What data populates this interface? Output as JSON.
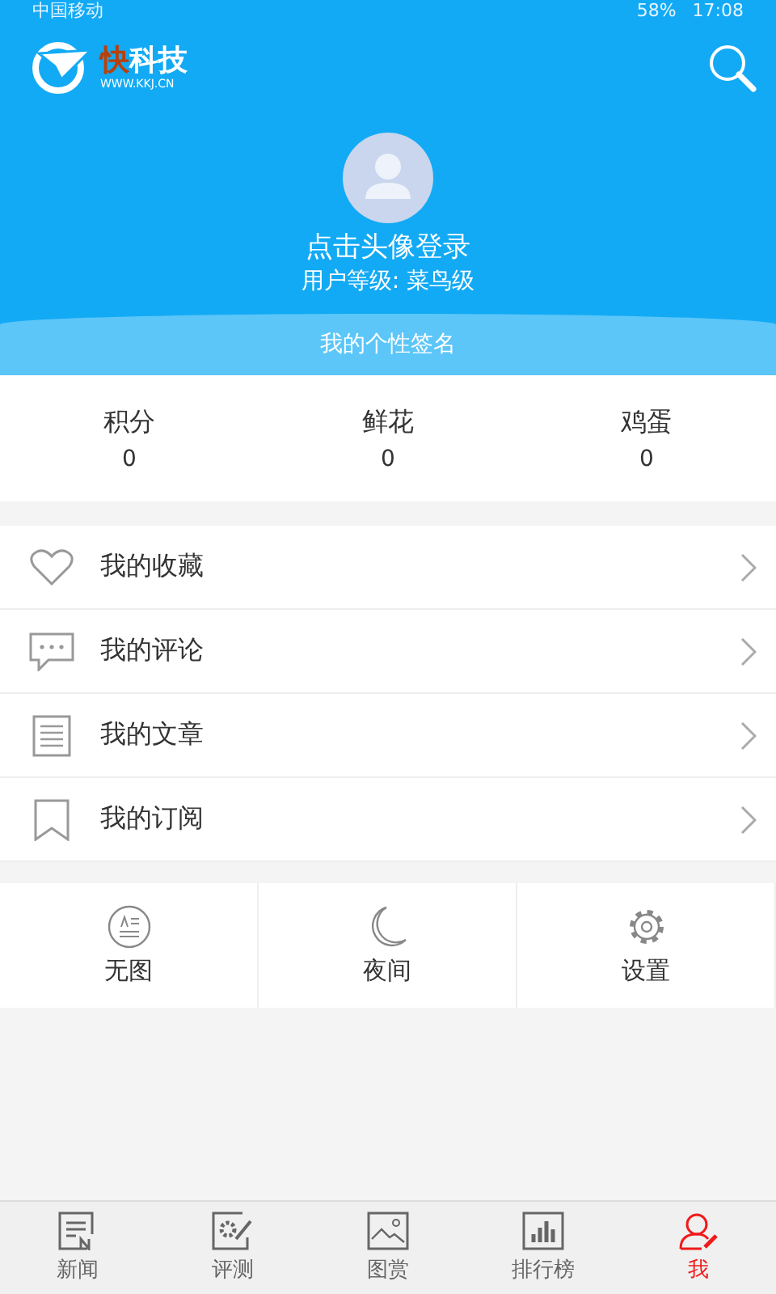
{
  "status_bar": {
    "carrier": "中国移动",
    "battery": "58%",
    "time": "17:08"
  },
  "header": {
    "logo": {
      "accent": "快",
      "name": "科技",
      "url": "WWW.KKJ.CN"
    }
  },
  "profile": {
    "login": "点击头像登录",
    "level": "用户等级: 菜鸟级",
    "signature": "我的个性签名"
  },
  "stats": [
    {
      "label": "积分",
      "value": "0"
    },
    {
      "label": "鲜花",
      "value": "0"
    },
    {
      "label": "鸡蛋",
      "value": "0"
    }
  ],
  "menu": [
    {
      "kind": "heart",
      "label": "我的收藏"
    },
    {
      "kind": "comment",
      "label": "我的评论"
    },
    {
      "kind": "article",
      "label": "我的文章"
    },
    {
      "kind": "bookmark",
      "label": "我的订阅"
    }
  ],
  "tools": [
    {
      "kind": "noimage",
      "label": "无图"
    },
    {
      "kind": "night",
      "label": "夜间"
    },
    {
      "kind": "settings",
      "label": "设置"
    }
  ],
  "tabs": [
    {
      "kind": "news",
      "label": "新闻",
      "selected": false
    },
    {
      "kind": "review",
      "label": "评测",
      "selected": false
    },
    {
      "kind": "gallery",
      "label": "图赏",
      "selected": false
    },
    {
      "kind": "ranking",
      "label": "排行榜",
      "selected": false
    },
    {
      "kind": "me",
      "label": "我",
      "selected": true
    }
  ]
}
